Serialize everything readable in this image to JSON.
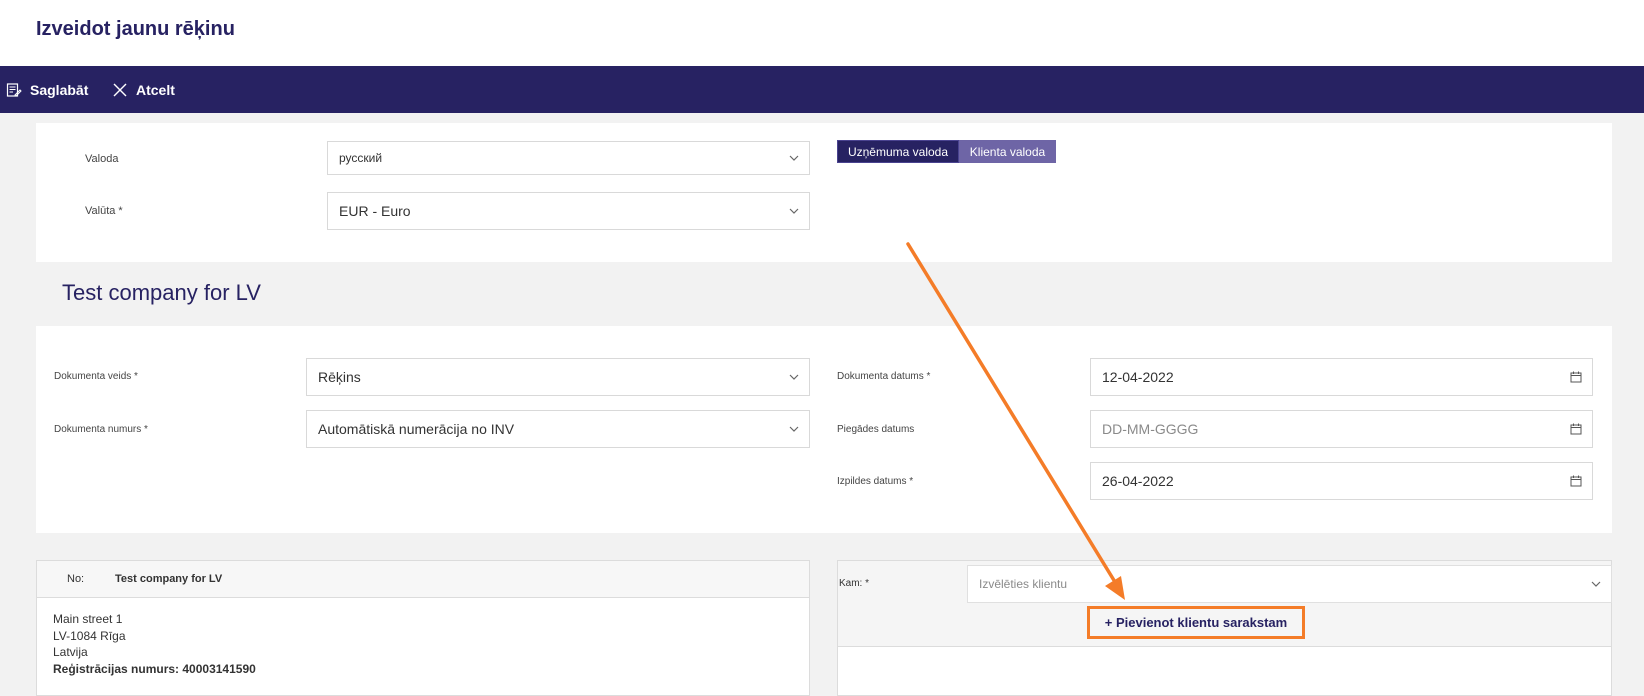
{
  "page": {
    "title": "Izveidot jaunu rēķinu"
  },
  "toolbar": {
    "save_label": "Saglabāt",
    "cancel_label": "Atcelt"
  },
  "language_section": {
    "language_label": "Valoda",
    "language_value": "русский",
    "currency_label": "Valūta *",
    "currency_value": "EUR - Euro",
    "company_language_button": "Uzņēmuma valoda",
    "client_language_button": "Klienta valoda"
  },
  "company_name": "Test company for LV",
  "document": {
    "type_label": "Dokumenta veids *",
    "type_value": "Rēķins",
    "number_label": "Dokumenta numurs *",
    "number_value": "Automātiskā numerācija no INV",
    "date_label": "Dokumenta datums *",
    "date_value": "12-04-2022",
    "delivery_label": "Piegādes datums",
    "delivery_placeholder": "DD-MM-GGGG",
    "due_label": "Izpildes datums *",
    "due_value": "26-04-2022"
  },
  "from": {
    "label": "No:",
    "name": "Test company for LV",
    "street": "Main street 1",
    "city": "LV-1084 Rīga",
    "country": "Latvija",
    "registration": "Reģistrācijas numurs: 40003141590"
  },
  "to": {
    "label": "Kam: *",
    "client_placeholder": "Izvēlēties klientu",
    "add_client_label": "+ Pievienot klientu sarakstam"
  },
  "colors": {
    "brand": "#272262",
    "annotation": "#f47c28",
    "active_toggle": "#272262",
    "inactive_toggle": "#6e65a6"
  }
}
